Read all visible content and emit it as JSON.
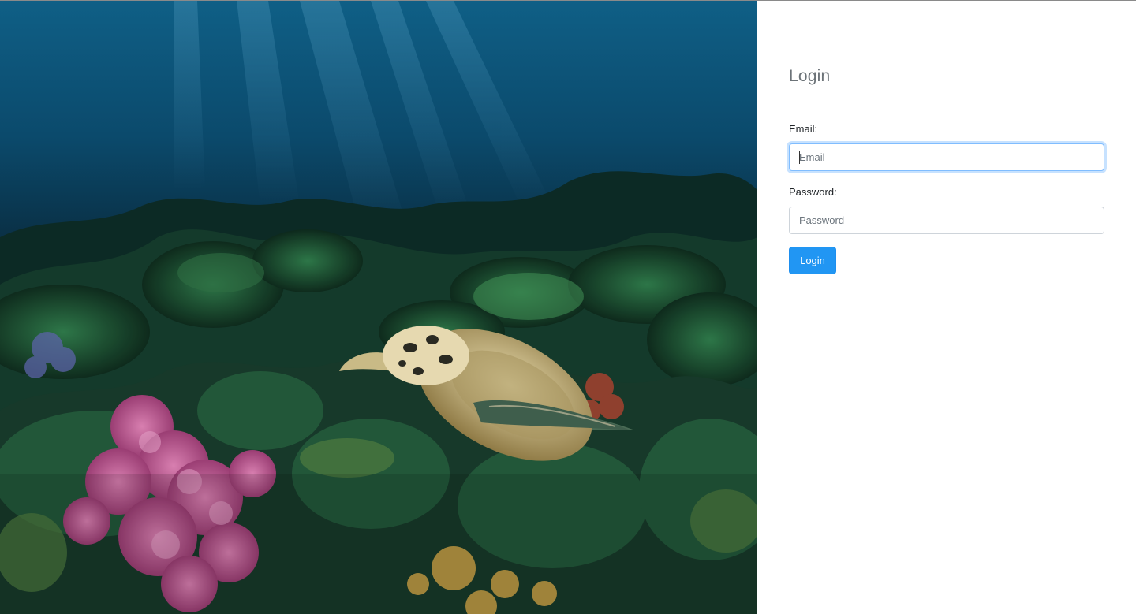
{
  "hero": {
    "image_name": "underwater-reef-sea-turtle"
  },
  "login": {
    "title": "Login",
    "email_label": "Email:",
    "email_placeholder": "Email",
    "email_value": "",
    "password_label": "Password:",
    "password_placeholder": "Password",
    "password_value": "",
    "submit_label": "Login"
  },
  "colors": {
    "accent": "#2196f3",
    "focus_ring": "#80bdff",
    "title": "#6c7378"
  }
}
